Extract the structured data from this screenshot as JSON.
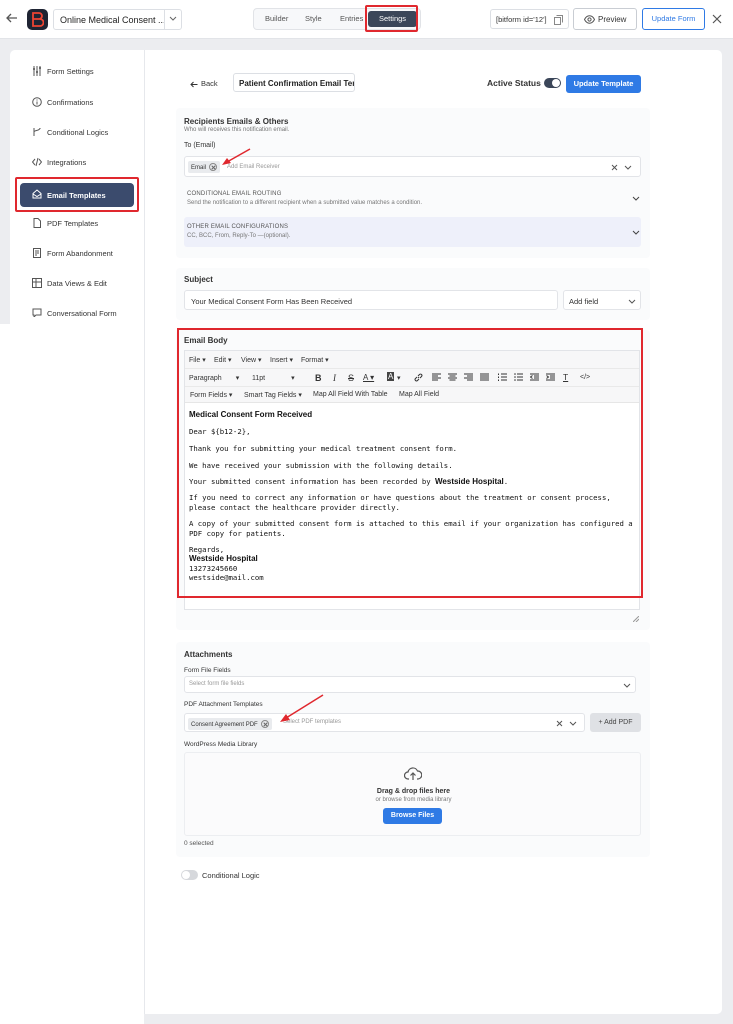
{
  "topbar": {
    "form_name": "Online Medical Consent ...",
    "tabs": [
      "Builder",
      "Style",
      "Entries",
      "Settings"
    ],
    "active_tab": "Settings",
    "shortcode": "[bitform id='12']",
    "preview_label": "Preview",
    "update_form_label": "Update Form"
  },
  "sidebar": {
    "items": [
      {
        "label": "Form Settings",
        "icon": "sliders-icon"
      },
      {
        "label": "Confirmations",
        "icon": "info-circle-icon"
      },
      {
        "label": "Conditional Logics",
        "icon": "branch-icon"
      },
      {
        "label": "Integrations",
        "icon": "code-icon"
      },
      {
        "label": "Email Templates",
        "icon": "home-mail-icon",
        "active": true
      },
      {
        "label": "PDF Templates",
        "icon": "document-icon"
      },
      {
        "label": "Form Abandonment",
        "icon": "form-icon"
      },
      {
        "label": "Data Views & Edit",
        "icon": "table-icon"
      },
      {
        "label": "Conversational Form",
        "icon": "chat-icon"
      }
    ]
  },
  "header": {
    "back_label": "Back",
    "template_name": "Patient Confirmation Email Ter",
    "active_status_label": "Active Status",
    "update_template_label": "Update Template"
  },
  "recipients": {
    "title": "Recipients Emails & Others",
    "subtitle": "Who will receives this notification email.",
    "to_label": "To (Email)",
    "chip": "Email",
    "placeholder": "Add Email Receiver",
    "routing_title": "CONDITIONAL EMAIL ROUTING",
    "routing_sub": "Send the notification to a different recipient when a submitted value matches a condition.",
    "other_title": "OTHER EMAIL CONFIGURATIONS",
    "other_sub": "CC, BCC, From, Reply-To —(optional)."
  },
  "subject": {
    "label": "Subject",
    "value": "Your Medical Consent Form Has Been Received",
    "add_field": "Add field"
  },
  "email_body": {
    "label": "Email Body",
    "menu": [
      "File",
      "Edit",
      "View",
      "Insert",
      "Format"
    ],
    "paragraph": "Paragraph",
    "font_size": "11pt",
    "buttons": [
      "Form Fields",
      "Smart Tag Fields",
      "Map All Field With Table",
      "Map All Field"
    ],
    "content": {
      "heading": "Medical Consent Form Received",
      "greeting": "Dear ${b12-2},",
      "line1": "Thank you for submitting your medical treatment consent form.",
      "line2": "We have received your submission with the following details.",
      "line3_pre": "Your submitted consent information has been recorded by ",
      "line3_bold": "Westside Hospital",
      "line3_post": ".",
      "line4": "If you need to correct any information or have questions about the treatment or consent process, please contact the healthcare provider directly.",
      "line5": "A copy of your submitted consent form is attached to this email if your organization has configured a PDF copy for patients.",
      "regards": "Regards,",
      "org": "Westside Hospital",
      "phone": "13273245660",
      "email": "westside@mail.com"
    }
  },
  "attachments": {
    "title": "Attachments",
    "form_file_label": "Form File Fields",
    "form_file_placeholder": "Select form file fields",
    "pdf_label": "PDF Attachment Templates",
    "pdf_chip": "Consent Agreement PDF",
    "pdf_placeholder": "Select PDF templates",
    "add_pdf": "+ Add PDF",
    "media_label": "WordPress Media Library",
    "drag_text": "Drag & drop files here",
    "browse_sub": "or browse from media library",
    "browse_btn": "Browse Files",
    "selected": "0 selected"
  },
  "conditional_logic": {
    "label": "Conditional Logic"
  },
  "colors": {
    "accent": "#2f7ae5",
    "dark": "#3b4659",
    "highlight": "#e0282e"
  }
}
